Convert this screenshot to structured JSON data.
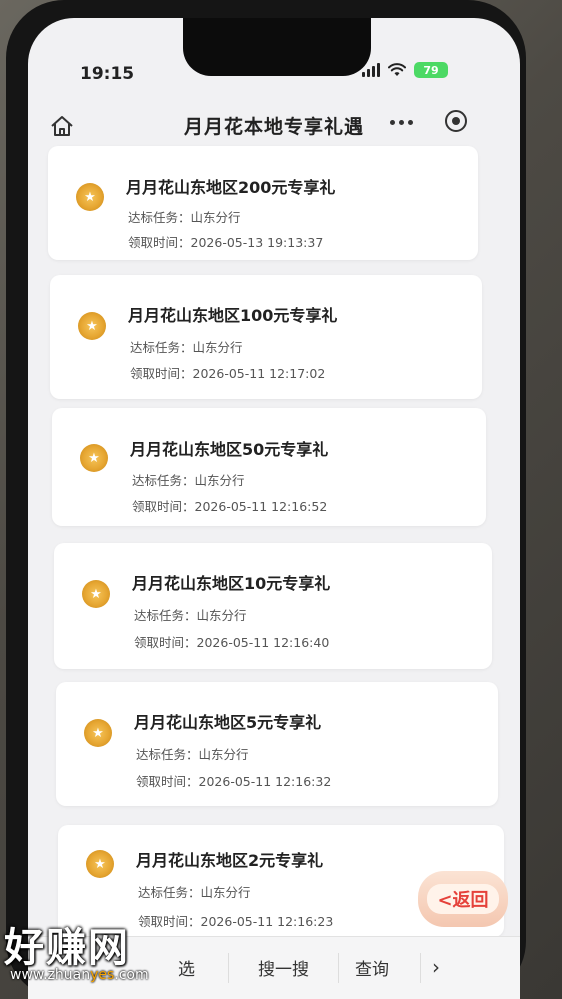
{
  "status_bar": {
    "time": "19:15",
    "battery": "79"
  },
  "nav": {
    "title": "月月花本地专享礼遇"
  },
  "labels": {
    "task_prefix": "达标任务：",
    "time_prefix": "领取时间："
  },
  "cards": [
    {
      "title": "月月花山东地区200元专享礼",
      "task": "山东分行",
      "time": "2026-05-13 19:13:37"
    },
    {
      "title": "月月花山东地区100元专享礼",
      "task": "山东分行",
      "time": "2026-05-11 12:17:02"
    },
    {
      "title": "月月花山东地区50元专享礼",
      "task": "山东分行",
      "time": "2026-05-11 12:16:52"
    },
    {
      "title": "月月花山东地区10元专享礼",
      "task": "山东分行",
      "time": "2026-05-11 12:16:40"
    },
    {
      "title": "月月花山东地区5元专享礼",
      "task": "山东分行",
      "time": "2026-05-11 12:16:32"
    },
    {
      "title": "月月花山东地区2元专享礼",
      "task": "山东分行",
      "time": "2026-05-11 12:16:23"
    }
  ],
  "floating_back": {
    "label": "<返回"
  },
  "tabbar": {
    "tab1_partial": "选",
    "tab2": "搜一搜",
    "tab3": "查询",
    "more": "›"
  },
  "watermark": {
    "main": "好赚网",
    "url_prefix": "www.zhuan",
    "url_accent": "yes",
    "url_suffix": ".com"
  }
}
